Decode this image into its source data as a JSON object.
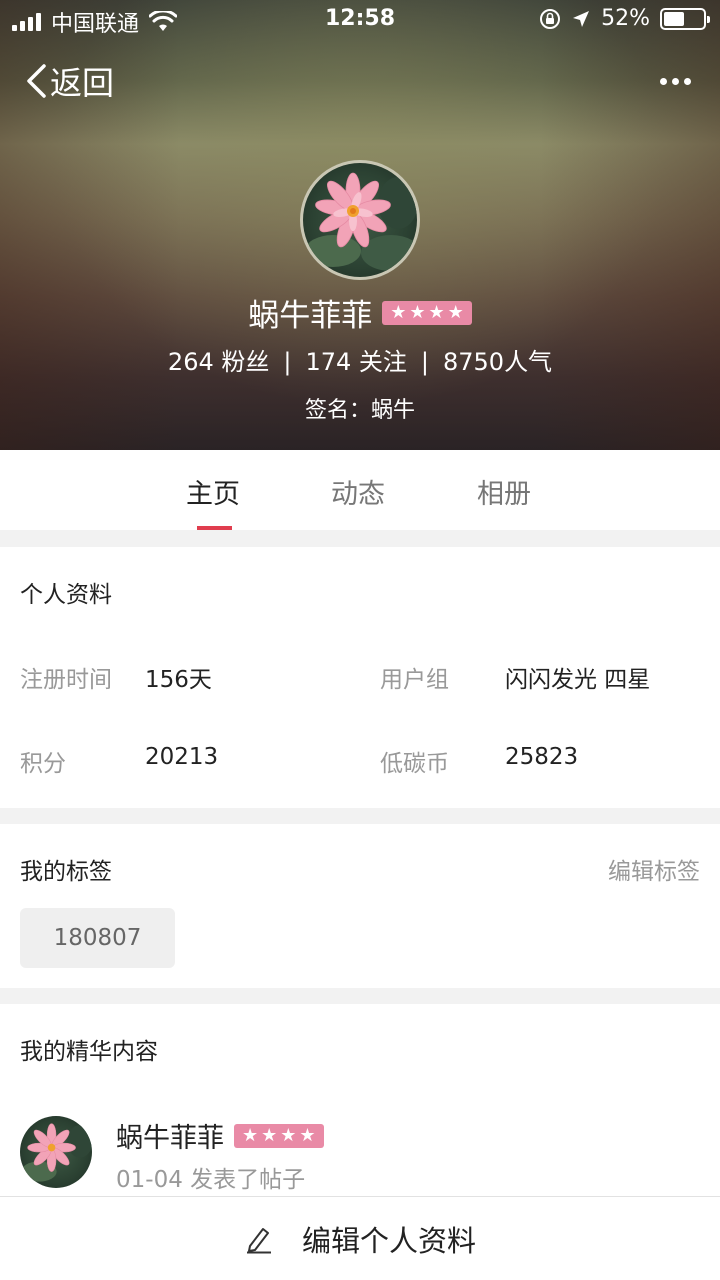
{
  "status_bar": {
    "carrier": "中国联通",
    "time": "12:58",
    "battery_percent": "52%",
    "battery_level": 0.52
  },
  "header": {
    "back_label": "返回",
    "more_icon": "more-dots-icon"
  },
  "profile": {
    "name": "蜗牛菲菲",
    "rank_stars": 4,
    "fans": "264 粉丝",
    "following": "174 关注",
    "popularity": "8750人气",
    "signature": "签名：蜗牛"
  },
  "tabs": [
    {
      "label": "主页",
      "active": true
    },
    {
      "label": "动态",
      "active": false
    },
    {
      "label": "相册",
      "active": false
    }
  ],
  "personal_info": {
    "title": "个人资料",
    "fields": [
      {
        "label": "注册时间",
        "value": "156天"
      },
      {
        "label": "用户组",
        "value": "闪闪发光 四星"
      },
      {
        "label": "积分",
        "value": "20213"
      },
      {
        "label": "低碳币",
        "value": "25823"
      }
    ]
  },
  "tags_section": {
    "title": "我的标签",
    "edit_label": "编辑标签",
    "tags": [
      "180807"
    ]
  },
  "featured": {
    "title": "我的精华内容",
    "post": {
      "author": "蜗牛菲菲",
      "meta": "01-04 发表了帖子"
    }
  },
  "bottom_action": {
    "label": "编辑个人资料",
    "icon": "pencil-icon"
  },
  "colors": {
    "accent_red": "#e03d4e",
    "badge_pink": "#e98aa6"
  }
}
